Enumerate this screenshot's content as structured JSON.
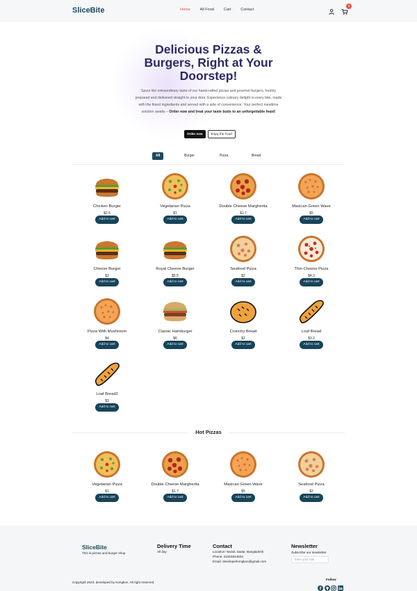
{
  "header": {
    "logo": "SliceBite",
    "nav": [
      "Home",
      "All Food",
      "Cart",
      "Contact"
    ],
    "active_nav": "Home",
    "cart_count": "0",
    "icons": [
      "user-icon",
      "cart-icon"
    ]
  },
  "hero": {
    "title": "Delicious Pizzas & Burgers, Right at Your Doorstep!",
    "description": "Savor the extraordinary taste of our handcrafted pizzas and gourmet burgers, freshly prepared and delivered straight to your door. Experience culinary delight in every bite, made with the finest ingredients and served with a side of convenience. Your perfect mealtime solution awaits –",
    "description_bold": "Order now and treat your taste buds to an unforgettable feast!",
    "order_button": "Order now",
    "enjoy_button": "Enjoy the Food"
  },
  "tabs": {
    "items": [
      "All",
      "Burger",
      "Pizza",
      "Bread"
    ],
    "active": "All"
  },
  "products": [
    {
      "name": "Chicken Burger",
      "price": "$2.5",
      "kind": "burger",
      "button": "Add to cart"
    },
    {
      "name": "Vegetarian Pizza",
      "price": "$1",
      "kind": "pizza-veg",
      "button": "Add to cart"
    },
    {
      "name": "Double Cheese Margherita",
      "price": "$1.7",
      "kind": "pizza-pep",
      "button": "Add to cart"
    },
    {
      "name": "Maxican Green Wave",
      "price": "$5",
      "kind": "pizza-orange",
      "button": "Add to cart"
    },
    {
      "name": "Cheese Burger",
      "price": "$3",
      "kind": "burger",
      "button": "Add to cart"
    },
    {
      "name": "Royal Cheese Burger",
      "price": "$5.5",
      "kind": "burger",
      "button": "Add to cart"
    },
    {
      "name": "Seafood Pizza",
      "price": "$2",
      "kind": "pizza-sea",
      "button": "Add to cart"
    },
    {
      "name": "Thin Cheese Pizza",
      "price": "$4.3",
      "kind": "pizza-thin",
      "button": "Add to cart"
    },
    {
      "name": "Pizza With Mushroom",
      "price": "$4",
      "kind": "pizza-orange",
      "button": "Add to cart"
    },
    {
      "name": "Classic Hamburger",
      "price": "$6",
      "kind": "burger-light",
      "button": "Add to cart"
    },
    {
      "name": "Crunchy Bread",
      "price": "$2",
      "kind": "bread-round",
      "button": "Add to cart"
    },
    {
      "name": "Loaf Bread",
      "price": "$3.2",
      "kind": "bread-loaf",
      "button": "Add to cart"
    },
    {
      "name": "Loaf Bread2",
      "price": "$3",
      "kind": "bread-loaf",
      "button": "Add to cart"
    }
  ],
  "hot_pizzas": {
    "title": "Hot Pizzas",
    "items": [
      {
        "name": "Vegetarian Pizza",
        "price": "$1",
        "kind": "pizza-veg",
        "button": "Add to cart"
      },
      {
        "name": "Double Cheese Margherita",
        "price": "$1.7",
        "kind": "pizza-pep",
        "button": "Add to cart"
      },
      {
        "name": "Maxican Green Wave",
        "price": "$5",
        "kind": "pizza-orange",
        "button": "Add to cart"
      },
      {
        "name": "Seafood Pizza",
        "price": "$2",
        "kind": "pizza-sea",
        "button": "Add to cart"
      }
    ]
  },
  "footer": {
    "logo": "SliceBite",
    "tagline": "This is pizzas and burger shop",
    "delivery_title": "Delivery Time",
    "delivery_text": "All day",
    "contact_title": "Contact",
    "location": "Location: Narail, Sadar, Bangladesh",
    "phone": "Phone: 01916814834",
    "email": "Email: developerkongkon@gmail.com",
    "newsletter_title": "Newsletter",
    "newsletter_text": "Subscribe our newsletter",
    "newsletter_placeholder": "Enter your mail",
    "copyright": "Copyright 2023, developed by Kongkon. All right reserved.",
    "follow": "Follow",
    "socials": [
      "facebook-icon",
      "github-icon",
      "instagram-icon",
      "linkedin-icon"
    ]
  },
  "colors": {
    "brand": "#1d4a5c",
    "button": "#16445a",
    "accent": "#e9534b",
    "hero_title": "#2b2a63"
  }
}
